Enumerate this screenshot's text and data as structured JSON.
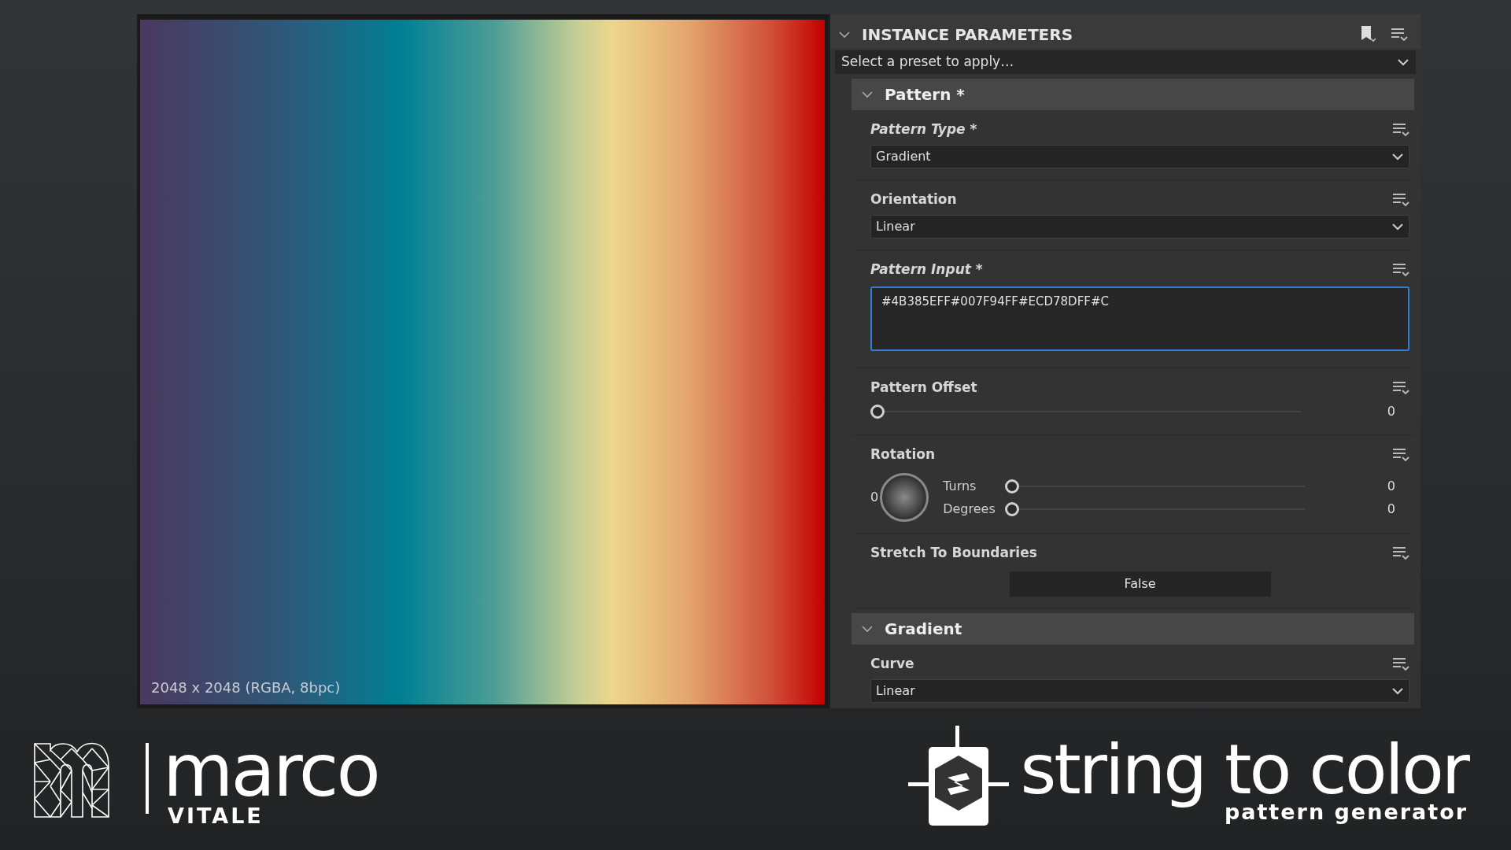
{
  "viewer": {
    "info": "2048 x 2048 (RGBA, 8bpc)"
  },
  "panel": {
    "title": "INSTANCE PARAMETERS",
    "expanded": true,
    "preset": "Select a preset to apply…"
  },
  "sections": [
    {
      "title": "Pattern *",
      "expanded": true,
      "params": [
        {
          "kind": "select",
          "label": "Pattern Type *",
          "modified": true,
          "value": "Gradient"
        },
        {
          "kind": "select",
          "label": "Orientation",
          "modified": false,
          "value": "Linear"
        },
        {
          "kind": "text",
          "label": "Pattern Input *",
          "modified": true,
          "value": "#4B385EFF#007F94FF#ECD78DFF#C",
          "focused": true
        },
        {
          "kind": "slider",
          "label": "Pattern Offset",
          "modified": false,
          "level": 0,
          "reading": "0"
        },
        {
          "kind": "rotation",
          "label": "Rotation",
          "modified": false,
          "dial_value": "0",
          "sliders": [
            {
              "label": "Turns",
              "level": 0,
              "reading": "0"
            },
            {
              "label": "Degrees",
              "level": 0,
              "reading": "0"
            }
          ]
        },
        {
          "kind": "toggle",
          "label": "Stretch To Boundaries",
          "modified": false,
          "value": "False"
        }
      ]
    },
    {
      "title": "Gradient",
      "expanded": true,
      "params": [
        {
          "kind": "select",
          "label": "Curve",
          "modified": false,
          "value": "Linear"
        }
      ]
    }
  ],
  "branding": [
    {
      "title": "marco",
      "subtitle": "VITALE"
    },
    {
      "title": "string to color",
      "subtitle": "pattern generator"
    }
  ]
}
